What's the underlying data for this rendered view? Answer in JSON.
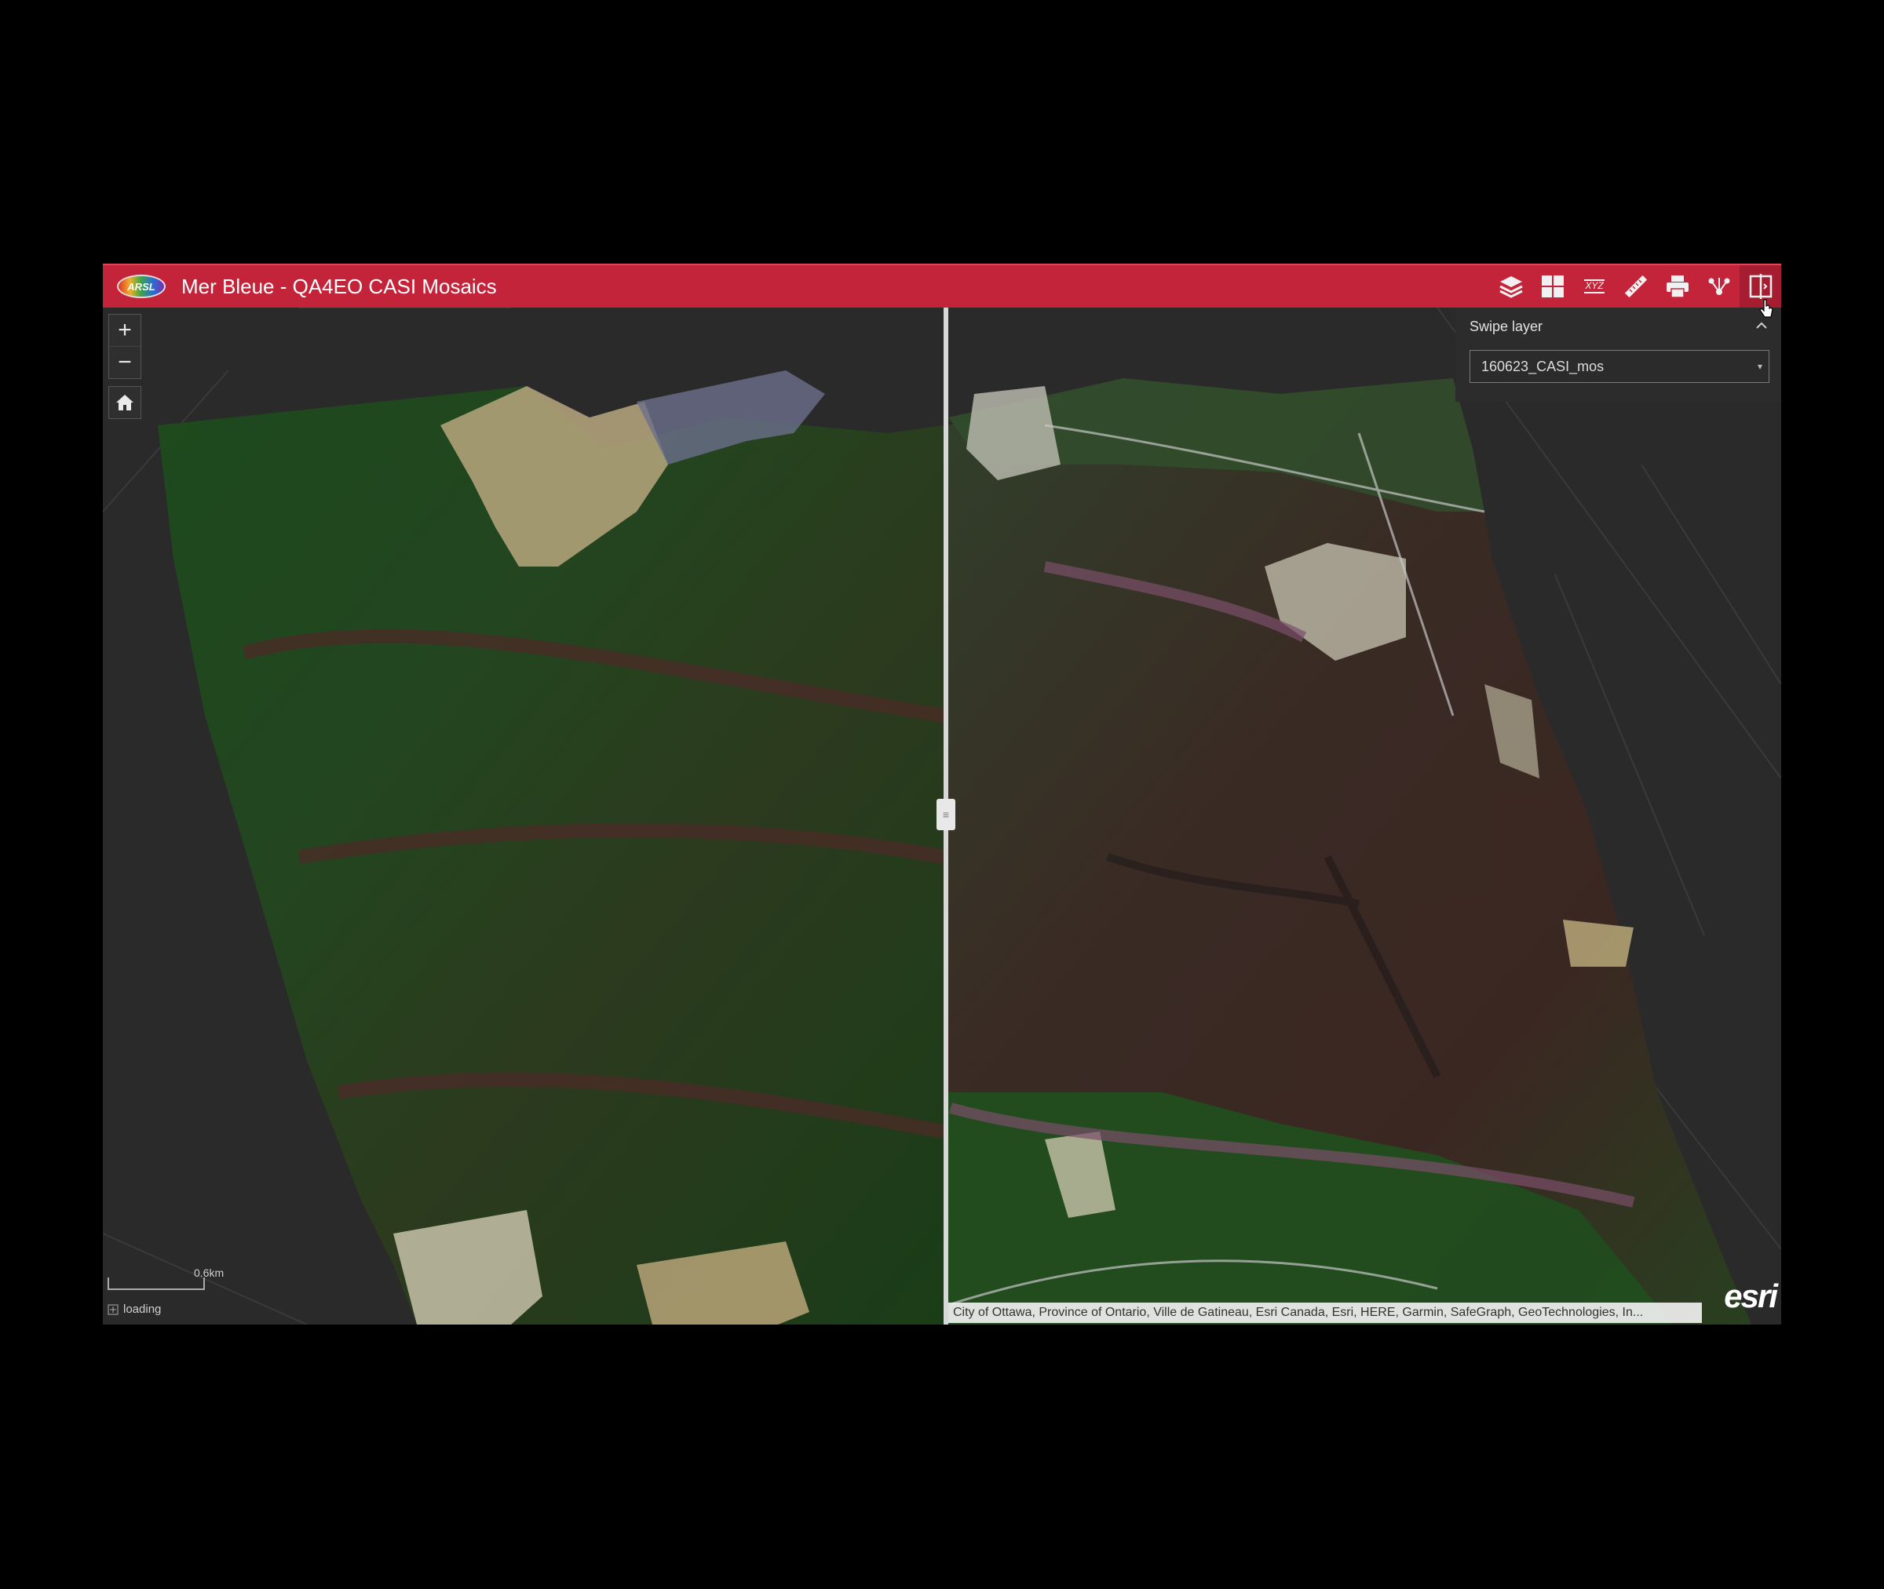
{
  "header": {
    "logo_text": "ARSL",
    "title": "Mer Bleue - QA4EO CASI Mosaics",
    "brand_color": "#c4243a"
  },
  "toolbar": {
    "tools": [
      {
        "icon": "layers-icon"
      },
      {
        "icon": "basemap-gallery-icon"
      },
      {
        "icon": "coordinate-conversion-icon",
        "label": "XYZ"
      },
      {
        "icon": "measure-icon"
      },
      {
        "icon": "print-icon"
      },
      {
        "icon": "share-icon"
      },
      {
        "icon": "swipe-icon",
        "active": true
      }
    ]
  },
  "map_controls": {
    "zoom_in": "+",
    "zoom_out": "−"
  },
  "swipe_panel": {
    "title": "Swipe layer",
    "selected_layer": "160623_CASI_mos"
  },
  "footer": {
    "scale_label": "0.6km",
    "status": "loading",
    "attribution": "City of Ottawa, Province of Ontario, Ville de Gatineau, Esri Canada, Esri, HERE, Garmin, SafeGraph, GeoTechnologies, In...",
    "esri_logo": "esri"
  }
}
